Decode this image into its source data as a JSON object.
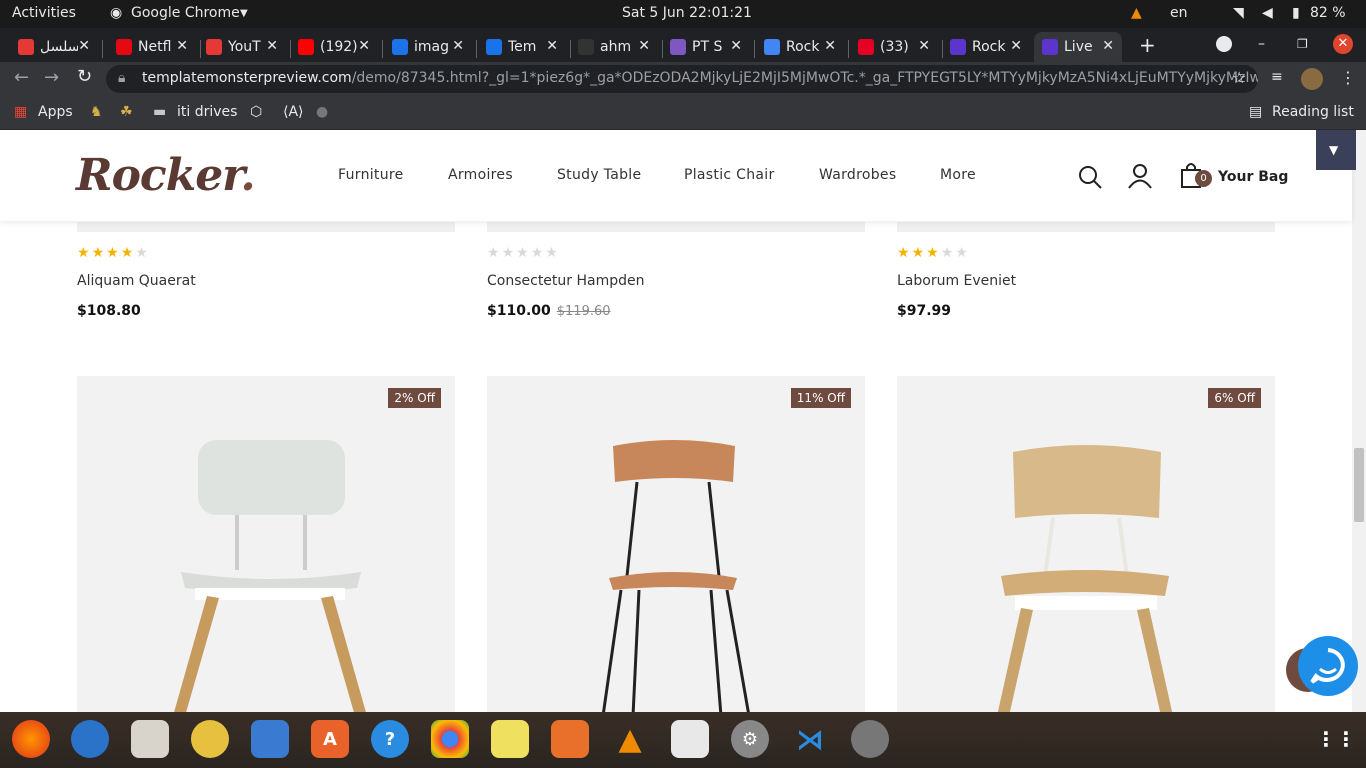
{
  "system": {
    "activities": "Activities",
    "app": "Google Chrome",
    "datetime": "Sat 5 Jun  22:01:21",
    "lang": "en",
    "battery": "82 %"
  },
  "tabs": [
    {
      "label": "مسلسل",
      "color": "#e53935"
    },
    {
      "label": "Netfl",
      "color": "#e50914"
    },
    {
      "label": "YouT",
      "color": "#e53935"
    },
    {
      "label": "(192)",
      "color": "#ff0000"
    },
    {
      "label": "imag",
      "color": "#1a73e8"
    },
    {
      "label": "Tem",
      "color": "#1a73e8"
    },
    {
      "label": "ahm",
      "color": "#333333"
    },
    {
      "label": "PT S",
      "color": "#7e57c2"
    },
    {
      "label": "Rock",
      "color": "#4285f4"
    },
    {
      "label": "(33)",
      "color": "#e60023"
    },
    {
      "label": "Rock",
      "color": "#5c35cc"
    },
    {
      "label": "Live",
      "color": "#5c35cc"
    }
  ],
  "url": {
    "domain": "templatemonsterpreview.com",
    "path": "/demo/87345.html?_gl=1*piez6g*_ga*ODEzODA2MjkyLjE2MjI5MjMwOTc.*_ga_FTPYEGT5LY*MTYyMjkyMzA5Ni4xLjEuMTYyMjkyMzIwMy..."
  },
  "bookmarks": {
    "apps": "Apps",
    "iti": "iti drives",
    "reading": "Reading list"
  },
  "site": {
    "logo": "Rocker",
    "nav": [
      "Furniture",
      "Armoires",
      "Study Table",
      "Plastic Chair",
      "Wardrobes",
      "More"
    ],
    "bag_label": "Your Bag",
    "bag_count": "0"
  },
  "products": [
    {
      "name": "Aliquam Quaerat",
      "price": "$108.80",
      "old_price": "",
      "rating": 4
    },
    {
      "name": "Consectetur Hampden",
      "price": "$110.00",
      "old_price": "$119.60",
      "rating": 0
    },
    {
      "name": "Laborum Eveniet",
      "price": "$97.99",
      "old_price": "",
      "rating": 3
    }
  ],
  "discounts": [
    "2% Off",
    "11% Off",
    "6% Off"
  ],
  "colors": {
    "accent": "#6f4a3f",
    "star": "#f5b301",
    "star_empty": "#d9d9d9"
  }
}
